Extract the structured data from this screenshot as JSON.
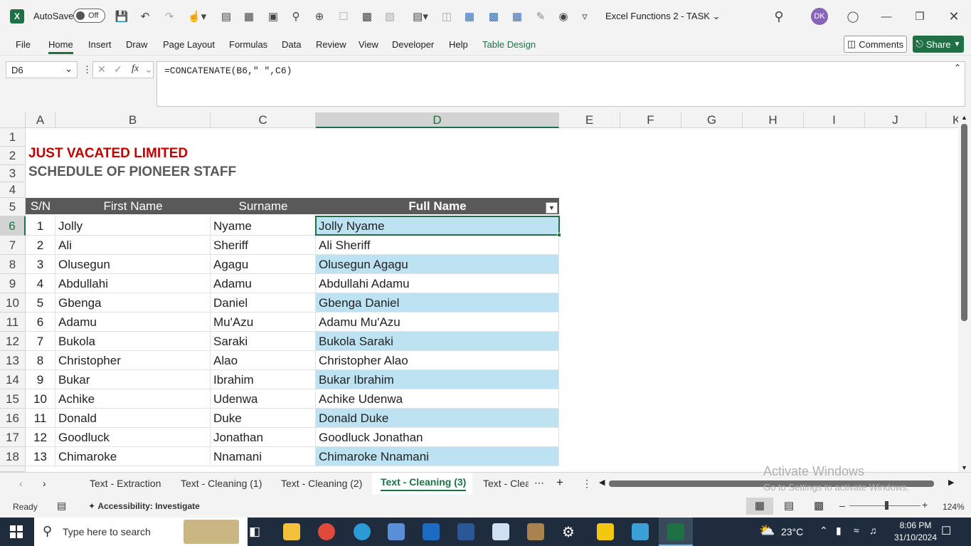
{
  "titlebar": {
    "autosave_label": "AutoSave",
    "autosave_state": "Off",
    "doc_title": "Excel Functions 2 - TASK",
    "user_initials": "DK",
    "avatar_color": "#8764b8"
  },
  "menubar": {
    "items": [
      "File",
      "Home",
      "Insert",
      "Draw",
      "Page Layout",
      "Formulas",
      "Data",
      "Review",
      "View",
      "Developer",
      "Help",
      "Table Design"
    ],
    "comments": "Comments",
    "share": "Share",
    "accent": "#1e7145"
  },
  "formula_bar": {
    "name_box": "D6",
    "fx": "fx",
    "formula": "=CONCATENATE(B6,\" \",C6)"
  },
  "columns": [
    "A",
    "B",
    "C",
    "D",
    "E",
    "F",
    "G",
    "H",
    "I",
    "J",
    "K"
  ],
  "rows": [
    "1",
    "2",
    "3",
    "4",
    "5",
    "6",
    "7",
    "8",
    "9",
    "10",
    "11",
    "12",
    "13",
    "14",
    "15",
    "16",
    "17",
    "18"
  ],
  "sheet": {
    "title": "JUST VACATED LIMITED",
    "title_color": "#c00000",
    "subtitle": "SCHEDULE OF PIONEER STAFF",
    "subtitle_color": "#595959",
    "headers": [
      "S/N",
      "First Name",
      "Surname",
      "Full Name"
    ],
    "header_bg": "#595959",
    "band_color": "#bde3f3",
    "records": [
      [
        "1",
        "Jolly",
        "Nyame",
        "Jolly Nyame"
      ],
      [
        "2",
        "Ali",
        "Sheriff",
        "Ali Sheriff"
      ],
      [
        "3",
        "Olusegun",
        "Agagu",
        "Olusegun Agagu"
      ],
      [
        "4",
        "Abdullahi",
        "Adamu",
        "Abdullahi Adamu"
      ],
      [
        "5",
        "Gbenga",
        "Daniel",
        "Gbenga Daniel"
      ],
      [
        "6",
        "Adamu",
        "Mu'Azu",
        "Adamu Mu'Azu"
      ],
      [
        "7",
        "Bukola",
        "Saraki",
        "Bukola Saraki"
      ],
      [
        "8",
        "Christopher",
        "Alao",
        "Christopher Alao"
      ],
      [
        "9",
        "Bukar",
        "Ibrahim",
        "Bukar Ibrahim"
      ],
      [
        "10",
        "Achike",
        "Udenwa",
        "Achike Udenwa"
      ],
      [
        "11",
        "Donald",
        "Duke",
        "Donald Duke"
      ],
      [
        "12",
        "Goodluck",
        "Jonathan",
        "Goodluck Jonathan"
      ],
      [
        "13",
        "Chimaroke",
        "Nnamani",
        "Chimaroke Nnamani"
      ]
    ]
  },
  "tabs": {
    "items": [
      "Text - Extraction",
      "Text - Cleaning (1)",
      "Text - Cleaning (2)",
      "Text - Cleaning (3)",
      "Text - Clea"
    ],
    "active": "Text - Cleaning (3)"
  },
  "watermark": {
    "line1": "Activate Windows",
    "line2": "Go to Settings to activate Windows."
  },
  "statusbar": {
    "ready": "Ready",
    "accessibility": "Accessibility: Investigate",
    "zoom": "124%"
  },
  "taskbar": {
    "search_placeholder": "Type here to search",
    "temperature": "23°C",
    "time": "8:06 PM",
    "date": "31/10/2024"
  }
}
